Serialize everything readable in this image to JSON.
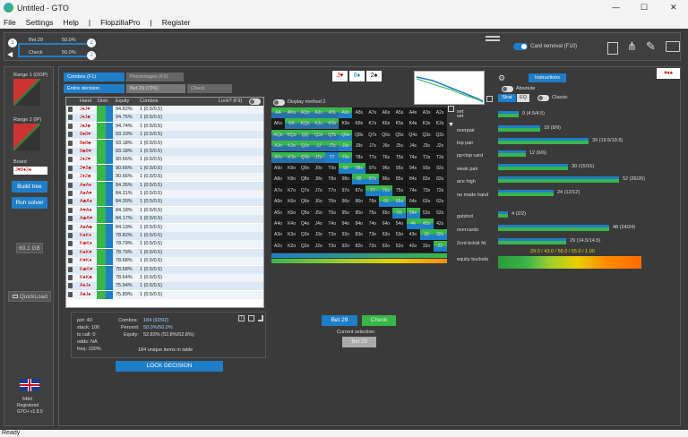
{
  "window": {
    "title": "Untitled - GTO",
    "minimize": "—",
    "maximize": "☐",
    "close": "✕"
  },
  "menu": [
    "File",
    "Settings",
    "Help",
    "|",
    "FlopzillaPro",
    "|",
    "Register"
  ],
  "topbar": {
    "node1": {
      "name": "Bet 29",
      "pct": "50.0%"
    },
    "node2": {
      "name": "Check",
      "pct": "50.0%"
    },
    "badge1": "1",
    "badge2": "2",
    "badge3": "1",
    "badge4": "2",
    "card_removal": "Card removal (F10)"
  },
  "sidebar": {
    "range_oop": "Range 1 (OOP)",
    "range_ip": "Range 2 (IP)",
    "board_label": "Board",
    "board_value": "J♥8♦2♠",
    "build_tree": "Build tree",
    "run_solver": "Run solver",
    "memory": "60.1 GB",
    "quickload": "QuickLoad",
    "bits": "64bit",
    "registered": "Registered",
    "version": "GTO+ v1.8.9"
  },
  "tabs": {
    "combos": "Combos (F1)",
    "percentages": "Percentages (F2)",
    "entire": "Entire decision",
    "bet": "Bet 29 (73%)",
    "check": "Check"
  },
  "table": {
    "headers": [
      "Hand",
      "Distr.",
      "Equity",
      "Combos"
    ],
    "lock_label": "Lock? (F9)",
    "rows": [
      [
        "J♦J♥",
        "94.82%",
        "1 (0.5/0.5)"
      ],
      [
        "J♦J♣",
        "94.75%",
        "1 (0.5/0.5)"
      ],
      [
        "J♠J♣",
        "94.74%",
        "1 (0.5/0.5)"
      ],
      [
        "8♠8♥",
        "93.19%",
        "1 (0.5/0.5)"
      ],
      [
        "8♠8♣",
        "93.18%",
        "1 (0.5/0.5)"
      ],
      [
        "8♣8♥",
        "93.18%",
        "1 (0.5/0.5)"
      ],
      [
        "2♦2♥",
        "90.66%",
        "1 (0.5/0.5)"
      ],
      [
        "2♥2♣",
        "90.66%",
        "1 (0.5/0.5)"
      ],
      [
        "2♦2♣",
        "90.66%",
        "1 (0.5/0.5)"
      ],
      [
        "A♠A♦",
        "84.35%",
        "1 (0.5/0.5)"
      ],
      [
        "A♠A♥",
        "84.31%",
        "1 (0.5/0.5)"
      ],
      [
        "A♣A♦",
        "84.30%",
        "1 (0.5/0.5)"
      ],
      [
        "A♥A♦",
        "84.18%",
        "1 (0.5/0.5)"
      ],
      [
        "A♣A♥",
        "84.17%",
        "1 (0.5/0.5)"
      ],
      [
        "A♠A♣",
        "84.13%",
        "1 (0.5/0.5)"
      ],
      [
        "K♠K♦",
        "78.82%",
        "1 (0.5/0.5)"
      ],
      [
        "K♣K♦",
        "78.79%",
        "1 (0.5/0.5)"
      ],
      [
        "K♠K♥",
        "78.79%",
        "1 (0.5/0.5)"
      ],
      [
        "K♥K♦",
        "78.68%",
        "1 (0.5/0.5)"
      ],
      [
        "K♣K♥",
        "78.68%",
        "1 (0.5/0.5)"
      ],
      [
        "K♠K♣",
        "78.64%",
        "1 (0.5/0.5)"
      ],
      [
        "A♦J♦",
        "75.94%",
        "1 (0.5/0.5)"
      ],
      [
        "A♠J♠",
        "75.89%",
        "1 (0.5/0.5)"
      ]
    ]
  },
  "summary": {
    "pot": "pot: 40",
    "stack": "stack: 100",
    "tocall": "to call: 0",
    "odds": "odds: NA",
    "freq": "freq: 100%",
    "combos_lbl": "Combos:",
    "combos_val": "184 (92/92)",
    "percent_lbl": "Percent:",
    "percent_val": "50.0%/50.0%",
    "equity_lbl": "Equity:",
    "equity_val": "52.83% (52.8%/52.8%)",
    "unique": "184 unique items in table"
  },
  "lock_decision": "LOCK DECISION",
  "matrix": {
    "board_cards": [
      "J♥",
      "8♦",
      "2♠"
    ],
    "display_method": "Display method 2",
    "set_label": "set",
    "rows": [
      [
        "AA",
        "AKs",
        "AQs",
        "AJs",
        "ATs",
        "A9s",
        "A8s",
        "A7s",
        "A6s",
        "A5s",
        "A4s",
        "A3s",
        "A2s"
      ],
      [
        "AKo",
        "KK",
        "KQs",
        "KJs",
        "KTs",
        "K9s",
        "K8s",
        "K7s",
        "K6s",
        "K5s",
        "K4s",
        "K3s",
        "K2s"
      ],
      [
        "AQo",
        "KQo",
        "QQ",
        "QJs",
        "QTs",
        "Q9s",
        "Q8s",
        "Q7s",
        "Q6s",
        "Q5s",
        "Q4s",
        "Q3s",
        "Q2s"
      ],
      [
        "AJo",
        "KJo",
        "QJo",
        "JJ",
        "JTs",
        "J9s",
        "J8s",
        "J7s",
        "J6s",
        "J5s",
        "J4s",
        "J3s",
        "J2s"
      ],
      [
        "ATo",
        "KTo",
        "QTo",
        "JTo",
        "TT",
        "T9s",
        "T8s",
        "T7s",
        "T6s",
        "T5s",
        "T4s",
        "T3s",
        "T2s"
      ],
      [
        "A9o",
        "K9o",
        "Q9o",
        "J9o",
        "T9o",
        "99",
        "98s",
        "97s",
        "96s",
        "95s",
        "94s",
        "93s",
        "92s"
      ],
      [
        "A8o",
        "K8o",
        "Q8o",
        "J8o",
        "T8o",
        "98o",
        "88",
        "87s",
        "86s",
        "85s",
        "84s",
        "83s",
        "82s"
      ],
      [
        "A7o",
        "K7o",
        "Q7o",
        "J7o",
        "T7o",
        "97o",
        "87o",
        "77",
        "76s",
        "75s",
        "74s",
        "73s",
        "72s"
      ],
      [
        "A6o",
        "K6o",
        "Q6o",
        "J6o",
        "T6o",
        "96o",
        "86o",
        "76o",
        "66",
        "65s",
        "64s",
        "63s",
        "62s"
      ],
      [
        "A5o",
        "K5o",
        "Q5o",
        "J5o",
        "T5o",
        "95o",
        "85o",
        "75o",
        "65o",
        "55",
        "54s",
        "53s",
        "52s"
      ],
      [
        "A4o",
        "K4o",
        "Q4o",
        "J4o",
        "T4o",
        "94o",
        "84o",
        "74o",
        "64o",
        "54o",
        "44",
        "43s",
        "42s"
      ],
      [
        "A3o",
        "K3o",
        "Q3o",
        "J3o",
        "T3o",
        "93o",
        "83o",
        "73o",
        "63o",
        "53o",
        "43o",
        "33",
        "32s"
      ],
      [
        "A2o",
        "K2o",
        "Q2o",
        "J2o",
        "T2o",
        "92o",
        "82o",
        "72o",
        "62o",
        "52o",
        "42o",
        "32o",
        "22"
      ]
    ]
  },
  "actions": {
    "bet": "Bet 29",
    "check": "Check",
    "current_selection": "Current selection:",
    "current_value": "Bet 29"
  },
  "strategy": {
    "instructions": "Instructions",
    "absolute": "Absolute",
    "strat": "Strat",
    "eq": "EQ",
    "classic": "Classic",
    "categories": [
      {
        "label": "set",
        "value": "9 (4.5/4.5)"
      },
      {
        "label": "overpair",
        "value": "18 (9/9)"
      },
      {
        "label": "top pair",
        "value": "39 (19.5/19.5)"
      },
      {
        "label": "pp<top card",
        "value": "12 (6/6)"
      },
      {
        "label": "weak pair",
        "value": "30 (15/15)"
      },
      {
        "label": "ace high",
        "value": "52 (26/26)"
      },
      {
        "label": "no made hand",
        "value": "24 (12/12)"
      },
      {
        "label": "gutshot",
        "value": "4 (2/2)"
      },
      {
        "label": "overcards",
        "value": "48 (24/24)"
      },
      {
        "label": "2crd bckdr fd.",
        "value": "29 (14.5/14.5)"
      },
      {
        "label": "equity buckets",
        "value": "29.0 / 43.0 / 56.0 / 55.0 / 1.00"
      }
    ],
    "fractions": [
      0.17,
      0.35,
      0.75,
      0.23,
      0.58,
      1.0,
      0.46,
      0.08,
      0.92,
      0.56
    ]
  },
  "colors": {
    "accent": "#1f7ec8",
    "strat_green": "#39b54a",
    "bg": "#3a3a3a"
  }
}
